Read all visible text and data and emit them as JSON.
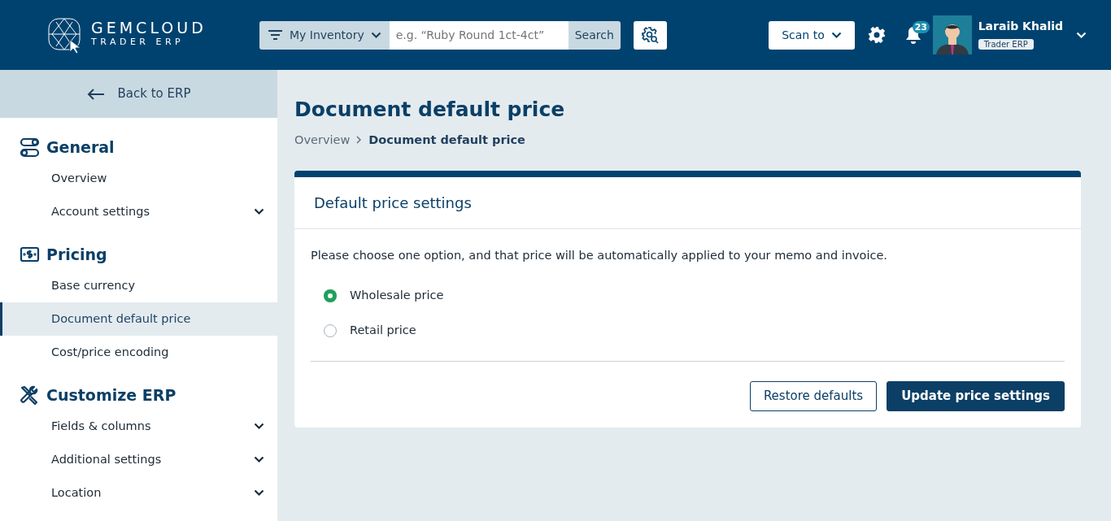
{
  "header": {
    "logo": {
      "name": "GEMCLOUD",
      "sub": "TRADER ERP"
    },
    "search": {
      "scope": "My Inventory",
      "placeholder": "e.g. “Ruby Round 1ct-4ct”",
      "button": "Search"
    },
    "scan": "Scan to",
    "notifications": "23",
    "user": {
      "name": "Laraib Khalid",
      "role": "Trader ERP"
    }
  },
  "sidebar": {
    "back": "Back to ERP",
    "sections": [
      {
        "title": "General",
        "kind": "toggles",
        "items": [
          {
            "label": "Overview",
            "expandable": false,
            "selected": false
          },
          {
            "label": "Account settings",
            "expandable": true,
            "selected": false
          }
        ]
      },
      {
        "title": "Pricing",
        "kind": "money",
        "items": [
          {
            "label": "Base currency",
            "expandable": false,
            "selected": false
          },
          {
            "label": "Document default price",
            "expandable": false,
            "selected": true
          },
          {
            "label": "Cost/price encoding",
            "expandable": false,
            "selected": false
          }
        ]
      },
      {
        "title": "Customize ERP",
        "kind": "tools",
        "items": [
          {
            "label": "Fields & columns",
            "expandable": true,
            "selected": false
          },
          {
            "label": "Additional settings",
            "expandable": true,
            "selected": false
          },
          {
            "label": "Location",
            "expandable": true,
            "selected": false
          }
        ]
      }
    ]
  },
  "page": {
    "title": "Document default price",
    "breadcrumb": [
      "Overview",
      "Document default price"
    ],
    "card": {
      "title": "Default price settings",
      "description": "Please choose one option, and that price will be automatically applied to your memo and invoice.",
      "options": [
        {
          "label": "Wholesale price",
          "selected": true
        },
        {
          "label": "Retail price",
          "selected": false
        }
      ],
      "buttons": [
        {
          "label": "Restore defaults",
          "kind": "secondary"
        },
        {
          "label": "Update price settings",
          "kind": "primary"
        }
      ]
    }
  }
}
